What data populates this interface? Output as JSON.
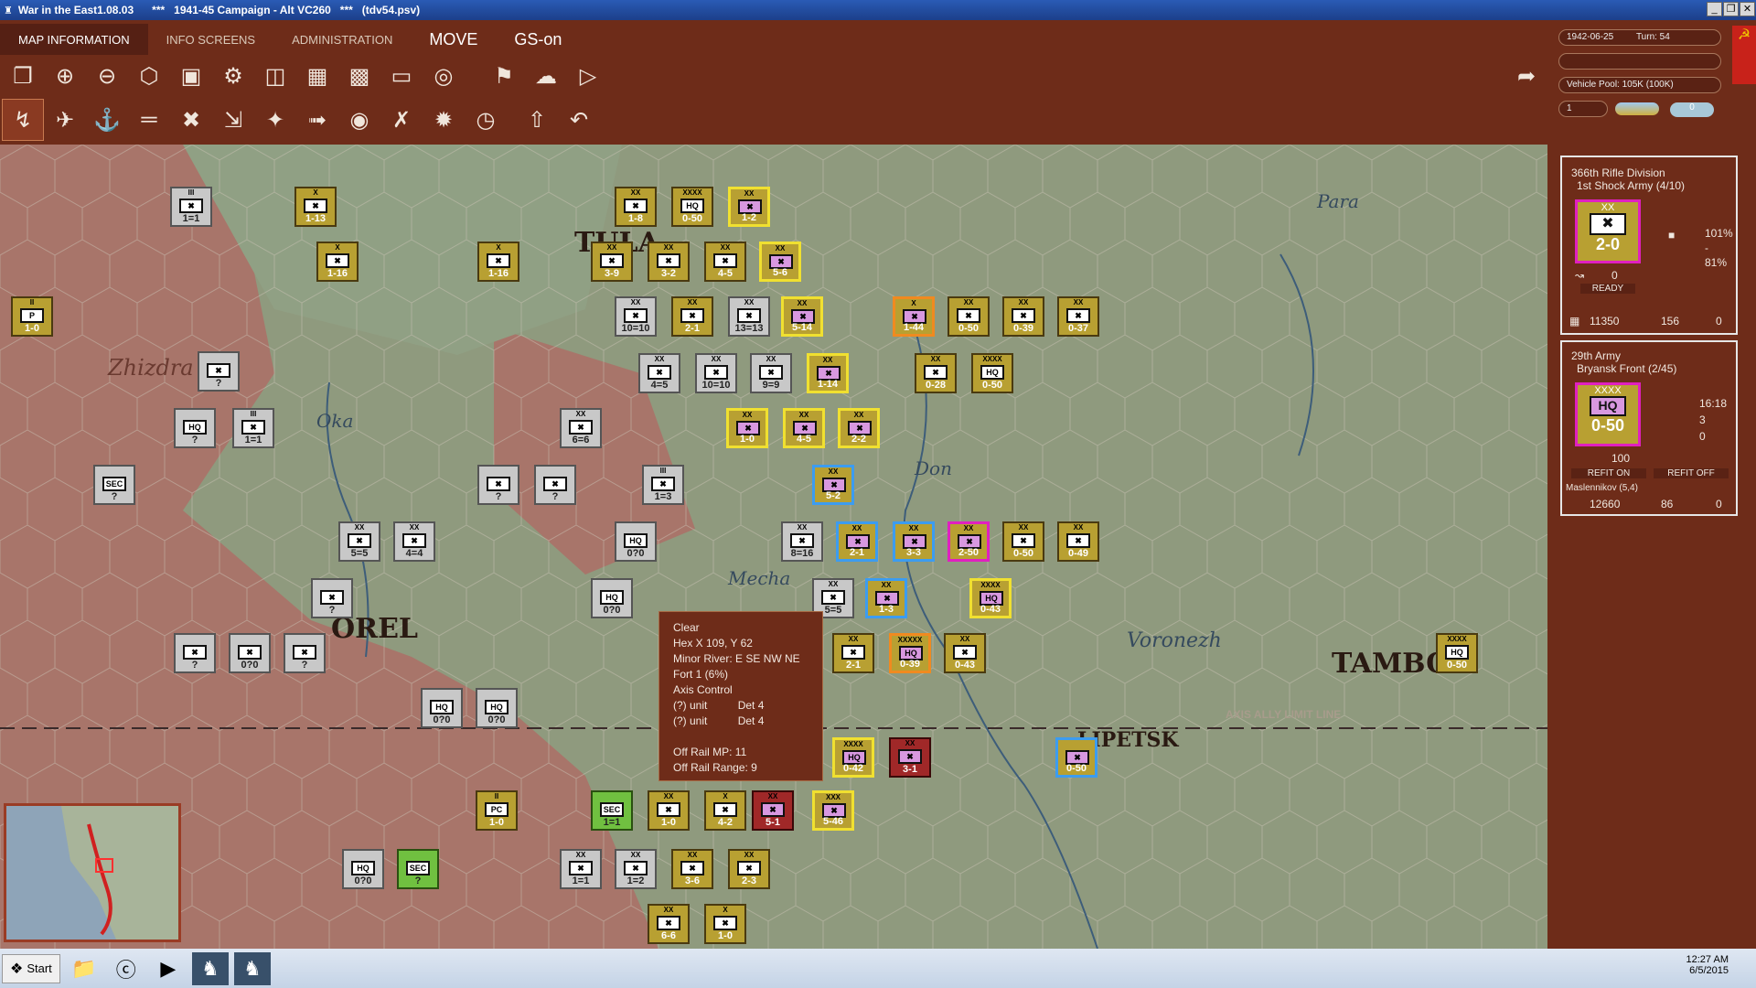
{
  "window": {
    "title": "War in the East1.08.03      ***   1941-45 Campaign - Alt VC260   ***   (tdv54.psv)"
  },
  "menu": {
    "tabs": [
      {
        "label": "MAP INFORMATION"
      },
      {
        "label": "INFO SCREENS"
      },
      {
        "label": "ADMINISTRATION"
      },
      {
        "label": "MOVE"
      },
      {
        "label": "GS-on"
      }
    ]
  },
  "toolbar_row1": {
    "icons": [
      "window-icon",
      "zoom-in-icon",
      "zoom-out-icon",
      "hex-icon",
      "frame-icon",
      "settings-icon",
      "map-icon",
      "chart-icon",
      "bar-chart-icon",
      "rectangle-icon",
      "target-icon",
      "flag-icon",
      "weather-icon",
      "play-flag-icon"
    ]
  },
  "toolbar_row2": {
    "icons": [
      "ground-mode-icon",
      "air-icon",
      "naval-icon",
      "rail-icon",
      "bomber-icon",
      "transport-icon",
      "fighter-icon",
      "ground-attack-icon",
      "air-recon-icon",
      "interdiction-icon",
      "explosion-icon",
      "clock-icon",
      "upload-icon",
      "undo-icon"
    ]
  },
  "right": {
    "date": "1942-06-25",
    "turn": "Turn: 54",
    "vehicle_pool": "Vehicle Pool: 105K (100K)",
    "field_value": "1",
    "counter_value": "0"
  },
  "unit_card1": {
    "name": "366th Rifle Division",
    "parent": "1st Shock Army (4/10)",
    "size": "XX",
    "value": "2-0",
    "pct1": "101%",
    "pct2": "-",
    "pct3": "81%",
    "mp": "0",
    "status": "READY",
    "men": "11350",
    "guns": "156",
    "tanks": "0"
  },
  "unit_card2": {
    "name": "29th Army",
    "parent": "Bryansk Front (2/45)",
    "size": "XXXX",
    "type": "HQ",
    "value": "0-50",
    "stat1": "16:18",
    "stat2": "3",
    "stat3": "0",
    "mp": "100",
    "refit_on": "REFIT ON",
    "refit_off": "REFIT OFF",
    "commander": "Maslennikov (5,4)",
    "men": "12660",
    "guns": "86",
    "tanks": "0"
  },
  "tooltip": {
    "lines": [
      "Clear",
      "Hex X 109, Y 62",
      "Minor River: E SE NW NE",
      "Fort  1 (6%)",
      "Axis Control",
      "(?) unit          Det 4",
      "(?) unit          Det 4",
      "",
      "Off Rail MP: 11",
      "Off Rail Range: 9"
    ]
  },
  "map_labels": {
    "tula": "TULA",
    "zhizdra": "Zhizdra",
    "orel": "OREL",
    "voronezh": "Voronezh",
    "tambov": "TAMBOV",
    "lipetsk": "LIPETSK",
    "oka": "Oka",
    "don": "Don",
    "para": "Para",
    "mecha": "Mecha",
    "limit_line": "AXIS ALLY LIMIT LINE"
  },
  "colors": {
    "soviet_gold": "#b8a032",
    "soviet_sel": "#f0e030",
    "axis_gray": "#c8c8c8",
    "blue_sel": "#3c9cf0",
    "magenta_sel": "#e020c0",
    "orange_sel": "#f08a20",
    "soviet_red": "#a02828",
    "green_unit": "#70c040",
    "pink_sym": "#d898e0"
  },
  "units": [
    {
      "v": "1-8",
      "s": "XX",
      "c": "g"
    },
    {
      "v": "0-50",
      "s": "XXXX",
      "c": "g",
      "t": "HQ"
    },
    {
      "v": "1-2",
      "s": "XX",
      "c": "y"
    },
    {
      "v": "1-13",
      "s": "X",
      "c": "g"
    },
    {
      "v": "1-16",
      "s": "X",
      "c": "g"
    },
    {
      "v": "1-16",
      "s": "X",
      "c": "g"
    },
    {
      "v": "3-9",
      "s": "XX",
      "c": "g"
    },
    {
      "v": "3-2",
      "s": "XX",
      "c": "g"
    },
    {
      "v": "4-5",
      "s": "XX",
      "c": "g"
    },
    {
      "v": "5-6",
      "s": "XX",
      "c": "y"
    },
    {
      "v": "1-0",
      "s": "II",
      "c": "g",
      "t": "P"
    },
    {
      "v": "10=10",
      "s": "XX",
      "c": "w"
    },
    {
      "v": "2-1",
      "s": "XX",
      "c": "g"
    },
    {
      "v": "13=13",
      "s": "XX",
      "c": "w"
    },
    {
      "v": "5-14",
      "s": "XX",
      "c": "y"
    },
    {
      "v": "1-44",
      "s": "X",
      "c": "o"
    },
    {
      "v": "0-50",
      "s": "XX",
      "c": "g"
    },
    {
      "v": "0-39",
      "s": "XX",
      "c": "g"
    },
    {
      "v": "0-37",
      "s": "XX",
      "c": "g"
    },
    {
      "v": "4=5",
      "s": "XX",
      "c": "w"
    },
    {
      "v": "10=10",
      "s": "XX",
      "c": "w"
    },
    {
      "v": "9=9",
      "s": "XX",
      "c": "w"
    },
    {
      "v": "1-14",
      "s": "XX",
      "c": "y"
    },
    {
      "v": "0-28",
      "s": "XX",
      "c": "g"
    },
    {
      "v": "0-50",
      "s": "XXXX",
      "c": "g",
      "t": "HQ"
    },
    {
      "v": "1=1",
      "s": "III",
      "c": "w"
    },
    {
      "v": "?",
      "s": "",
      "c": "w"
    },
    {
      "v": "?",
      "s": "",
      "c": "w",
      "t": "HQ"
    },
    {
      "v": "1=1",
      "s": "III",
      "c": "w"
    },
    {
      "v": "6=6",
      "s": "XX",
      "c": "w"
    },
    {
      "v": "1-0",
      "s": "XX",
      "c": "y"
    },
    {
      "v": "4-5",
      "s": "XX",
      "c": "y"
    },
    {
      "v": "2-2",
      "s": "XX",
      "c": "y"
    },
    {
      "v": "?",
      "s": "",
      "c": "w",
      "t": "SEC"
    },
    {
      "v": "?",
      "s": "",
      "c": "w"
    },
    {
      "v": "?",
      "s": "",
      "c": "w"
    },
    {
      "v": "1=3",
      "s": "III",
      "c": "w"
    },
    {
      "v": "5-2",
      "s": "XX",
      "c": "b"
    },
    {
      "v": "5=5",
      "s": "XX",
      "c": "w"
    },
    {
      "v": "4=4",
      "s": "XX",
      "c": "w"
    },
    {
      "v": "0?0",
      "s": "",
      "c": "w",
      "t": "HQ"
    },
    {
      "v": "8=16",
      "s": "XX",
      "c": "w"
    },
    {
      "v": "2-1",
      "s": "XX",
      "c": "b"
    },
    {
      "v": "3-3",
      "s": "XX",
      "c": "b"
    },
    {
      "v": "2-50",
      "s": "XX",
      "c": "m"
    },
    {
      "v": "0-50",
      "s": "XX",
      "c": "g"
    },
    {
      "v": "0-49",
      "s": "XX",
      "c": "g"
    },
    {
      "v": "?",
      "s": "",
      "c": "w"
    },
    {
      "v": "0?0",
      "s": "",
      "c": "w",
      "t": "HQ"
    },
    {
      "v": "5=5",
      "s": "XX",
      "c": "w"
    },
    {
      "v": "1-3",
      "s": "XX",
      "c": "b"
    },
    {
      "v": "0-43",
      "s": "XXXX",
      "c": "y",
      "t": "HQ"
    },
    {
      "v": "?",
      "s": "",
      "c": "w"
    },
    {
      "v": "0?0",
      "s": "",
      "c": "w"
    },
    {
      "v": "?",
      "s": "",
      "c": "w"
    },
    {
      "v": "2-1",
      "s": "XX",
      "c": "g"
    },
    {
      "v": "0-39",
      "s": "XXXXX",
      "c": "o",
      "t": "HQ"
    },
    {
      "v": "0-43",
      "s": "XX",
      "c": "g"
    },
    {
      "v": "0-50",
      "s": "XXXX",
      "c": "g",
      "t": "HQ"
    },
    {
      "v": "0?0",
      "s": "",
      "c": "w",
      "t": "HQ"
    },
    {
      "v": "0?0",
      "s": "",
      "c": "w",
      "t": "HQ"
    },
    {
      "v": "0-42",
      "s": "XXXX",
      "c": "y",
      "t": "HQ"
    },
    {
      "v": "3-1",
      "s": "XX",
      "c": "r"
    },
    {
      "v": "0-50",
      "s": "",
      "c": "b"
    },
    {
      "v": "1-0",
      "s": "II",
      "c": "g",
      "t": "PC"
    },
    {
      "v": "1=1",
      "s": "",
      "c": "n",
      "t": "SEC"
    },
    {
      "v": "1-0",
      "s": "XX",
      "c": "g"
    },
    {
      "v": "4-2",
      "s": "X",
      "c": "g"
    },
    {
      "v": "5-1",
      "s": "XX",
      "c": "r"
    },
    {
      "v": "5-46",
      "s": "XXX",
      "c": "y"
    },
    {
      "v": "0?0",
      "s": "",
      "c": "w",
      "t": "HQ"
    },
    {
      "v": "?",
      "s": "",
      "c": "n",
      "t": "SEC"
    },
    {
      "v": "1=1",
      "s": "XX",
      "c": "w"
    },
    {
      "v": "1=2",
      "s": "XX",
      "c": "w"
    },
    {
      "v": "3-6",
      "s": "XX",
      "c": "g"
    },
    {
      "v": "2-3",
      "s": "XX",
      "c": "g"
    },
    {
      "v": "6-6",
      "s": "XX",
      "c": "g"
    },
    {
      "v": "1-0",
      "s": "X",
      "c": "g"
    }
  ],
  "taskbar": {
    "start": "Start",
    "time": "12:27 AM",
    "date": "6/5/2015"
  }
}
